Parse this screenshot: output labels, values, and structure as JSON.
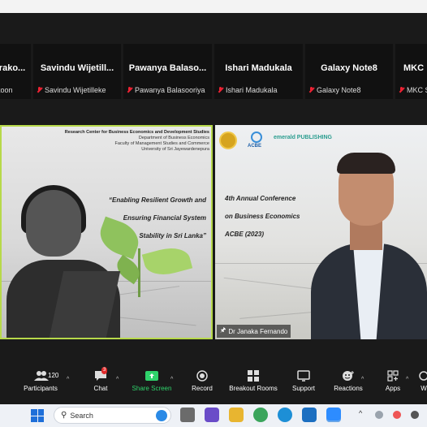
{
  "gallery": {
    "participants": [
      {
        "name": "rako...",
        "label": "koon"
      },
      {
        "name": "Savindu  Wijetill...",
        "label": "Savindu Wijetilleke"
      },
      {
        "name": "Pawanya  Balaso...",
        "label": "Pawanya Balasooriya"
      },
      {
        "name": "Ishari Madukala",
        "label": "Ishari Madukala"
      },
      {
        "name": "Galaxy Note8",
        "label": "Galaxy Note8"
      },
      {
        "name": "MKC",
        "label": "MKC S"
      }
    ]
  },
  "share_left": {
    "org_lines": [
      "Research Center for Business Economics and Development Studies",
      "Department of Business Economics",
      "Faculty of Management Studies and Commerce",
      "University of Sri Jayewardenepura"
    ],
    "slogan": [
      "“Enabling Resilient Growth and",
      "Ensuring Financial System",
      "Stability in Sri Lanka”"
    ]
  },
  "share_right": {
    "conference": [
      "4th Annual Conference",
      "on Business Economics",
      "ACBE (2023)"
    ],
    "logo_text_2": "ACBE",
    "logo_text_3": "emerald PUBLISHING",
    "speaker_name": "Dr Janaka Fernando"
  },
  "controls": {
    "participants_count": "120",
    "participants": "Participants",
    "chat": "Chat",
    "chat_badge": "3",
    "share_screen": "Share Screen",
    "record": "Record",
    "breakout_rooms": "Breakout Rooms",
    "support": "Support",
    "reactions": "Reactions",
    "apps": "Apps",
    "more": "W"
  },
  "taskbar": {
    "search_placeholder": "Search"
  },
  "colors": {
    "active_speaker_border": "#b7d94a",
    "share_green": "#2fd36b",
    "badge_red": "#e02b2b"
  }
}
